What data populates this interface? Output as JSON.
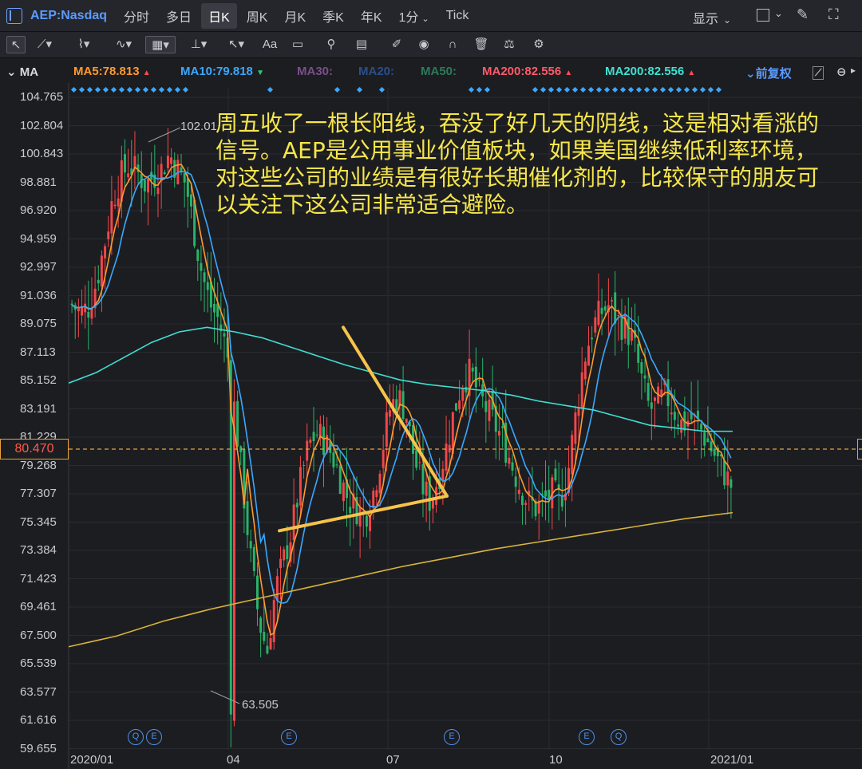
{
  "topbar": {
    "symbol": "AEP:Nasdaq",
    "periods": [
      "分时",
      "多日",
      "日K",
      "周K",
      "月K",
      "季K",
      "年K",
      "1分",
      "Tick"
    ],
    "active_period": "日K",
    "display_label": "显示"
  },
  "ma_bar": {
    "ma_label": "MA",
    "ma5": "MA5:78.813",
    "ma10": "MA10:79.818",
    "ma30": "MA30:",
    "ma20": "MA20:",
    "ma50": "MA50:",
    "ma200a": "MA200:82.556",
    "ma200b": "MA200:82.556",
    "adjust": "前复权",
    "colors": {
      "ma5": "#ff9a2e",
      "ma10": "#3aa8ff",
      "ma30": "#7a4f8a",
      "ma20": "#2a4f8a",
      "ma50": "#2d7a5a",
      "ma200a": "#ff5a6a",
      "ma200b": "#3fe0d0"
    }
  },
  "y_axis": [
    "104.765",
    "102.804",
    "100.843",
    "98.881",
    "96.920",
    "94.959",
    "92.997",
    "91.036",
    "89.075",
    "87.113",
    "85.152",
    "83.191",
    "81.229",
    "80.470",
    "79.268",
    "77.307",
    "75.345",
    "73.384",
    "71.423",
    "69.461",
    "67.500",
    "65.539",
    "63.577",
    "61.616",
    "59.655"
  ],
  "current_price": "80.470",
  "x_axis": [
    "2020/01",
    "04",
    "07",
    "10",
    "2021/01"
  ],
  "high_label": "102.01",
  "low_label": "63.505",
  "annotation": "周五收了一根长阳线，吞没了好几天的阴线，这是相对看涨的信号。AEP是公用事业价值板块，如果美国继续低利率环境，对这些公司的业绩是有很好长期催化剂的，比较保守的朋友可以关注下这公司非常适合避险。",
  "events": [
    "Q",
    "E",
    "E",
    "E",
    "E",
    "Q"
  ],
  "chart_data": {
    "type": "candlestick",
    "symbol": "AEP:Nasdaq",
    "period": "日K",
    "ylim": [
      59.655,
      104.765
    ],
    "x_ticks": [
      "2020/01",
      "04",
      "07",
      "10",
      "2021/01"
    ],
    "high": 102.01,
    "low": 63.505,
    "last": 80.47,
    "close_path": [
      91.0,
      90.5,
      90.8,
      92.5,
      95.0,
      98.0,
      99.5,
      100.3,
      99.8,
      99.0,
      99.5,
      100.0,
      101.0,
      100.0,
      99.0,
      96.0,
      93.0,
      91.0,
      90.0,
      88.0,
      84.0,
      79.0,
      74.0,
      70.0,
      68.0,
      72.0,
      74.0,
      76.0,
      79.0,
      81.5,
      82.5,
      82.0,
      81.0,
      79.5,
      78.0,
      77.5,
      77.0,
      78.5,
      81.0,
      84.0,
      85.0,
      84.0,
      81.0,
      79.0,
      78.0,
      79.5,
      81.5,
      84.0,
      86.0,
      86.5,
      85.0,
      84.0,
      83.0,
      82.0,
      80.5,
      79.0,
      78.0,
      77.5,
      78.0,
      78.5,
      78.0,
      80.0,
      84.0,
      87.5,
      89.5,
      90.5,
      91.0,
      90.0,
      89.5,
      88.5,
      86.0,
      84.0,
      84.5,
      85.0,
      84.0,
      83.0,
      83.5,
      83.0,
      82.0,
      81.0,
      80.0,
      79.0
    ],
    "ma200_path": [
      85.8,
      86.5,
      87.5,
      88.5,
      89.2,
      89.5,
      89.2,
      88.8,
      88.2,
      87.6,
      87.0,
      86.5,
      86.0,
      85.7,
      85.5,
      85.3,
      85.0,
      84.6,
      84.3,
      84.0,
      83.5,
      83.0,
      82.8,
      82.6,
      82.6
    ],
    "ma250_path": [
      68.3,
      69.0,
      70.0,
      70.8,
      71.5,
      72.2,
      72.9,
      73.6,
      74.2,
      74.8,
      75.3,
      75.8,
      76.3,
      76.8,
      77.2
    ],
    "trendlines": [
      {
        "name": "upper",
        "from": [
          430,
          89.5
        ],
        "to": [
          560,
          78.3
        ]
      },
      {
        "name": "lower",
        "from": [
          350,
          76.0
        ],
        "to": [
          560,
          78.3
        ]
      }
    ]
  }
}
